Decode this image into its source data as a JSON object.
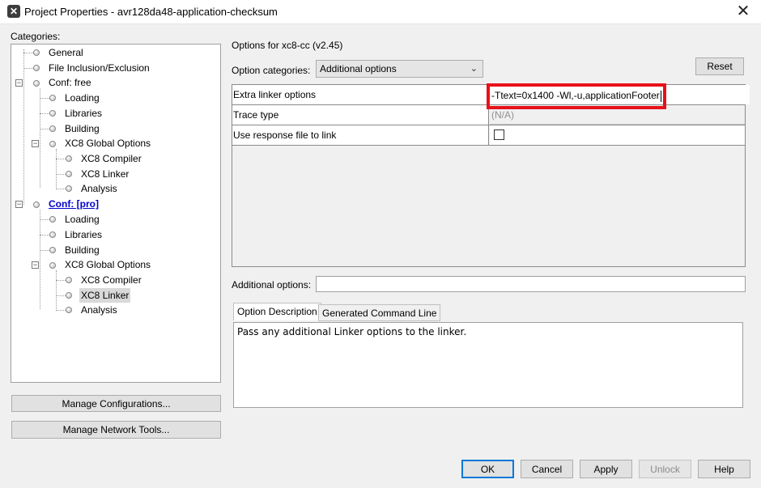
{
  "window": {
    "title": "Project Properties - avr128da48-application-checksum"
  },
  "categories_label": "Categories:",
  "tree": {
    "general": "General",
    "file_inclusion": "File Inclusion/Exclusion",
    "conf_free": "Conf: free",
    "free_loading": "Loading",
    "free_libraries": "Libraries",
    "free_building": "Building",
    "free_xc8_global": "XC8 Global Options",
    "free_xc8_compiler": "XC8 Compiler",
    "free_xc8_linker": "XC8 Linker",
    "free_analysis": "Analysis",
    "conf_pro": "Conf: [pro]",
    "pro_loading": "Loading",
    "pro_libraries": "Libraries",
    "pro_building": "Building",
    "pro_xc8_global": "XC8 Global Options",
    "pro_xc8_compiler": "XC8 Compiler",
    "pro_xc8_linker": "XC8 Linker",
    "pro_analysis": "Analysis"
  },
  "left_buttons": {
    "manage_configurations": "Manage Configurations...",
    "manage_network_tools": "Manage Network Tools..."
  },
  "options": {
    "header": "Options for xc8-cc (v2.45)",
    "categories_label": "Option categories:",
    "categories_selected": "Additional options",
    "reset_label": "Reset",
    "rows": [
      {
        "name": "Extra linker options",
        "value": "-Ttext=0x1400 -Wl,-u,applicationFooter"
      },
      {
        "name": "Trace type",
        "value": "(N/A)"
      },
      {
        "name": "Use response file to link",
        "value": ""
      }
    ],
    "additional_label": "Additional options:",
    "additional_value": ""
  },
  "tabs": {
    "description": "Option Description",
    "command_line": "Generated Command Line"
  },
  "description_text": "Pass any additional Linker options to the linker.",
  "bottom_buttons": {
    "ok": "OK",
    "cancel": "Cancel",
    "apply": "Apply",
    "unlock": "Unlock",
    "help": "Help"
  },
  "colors": {
    "highlight": "#e8101a",
    "default_button_border": "#0078d7"
  }
}
